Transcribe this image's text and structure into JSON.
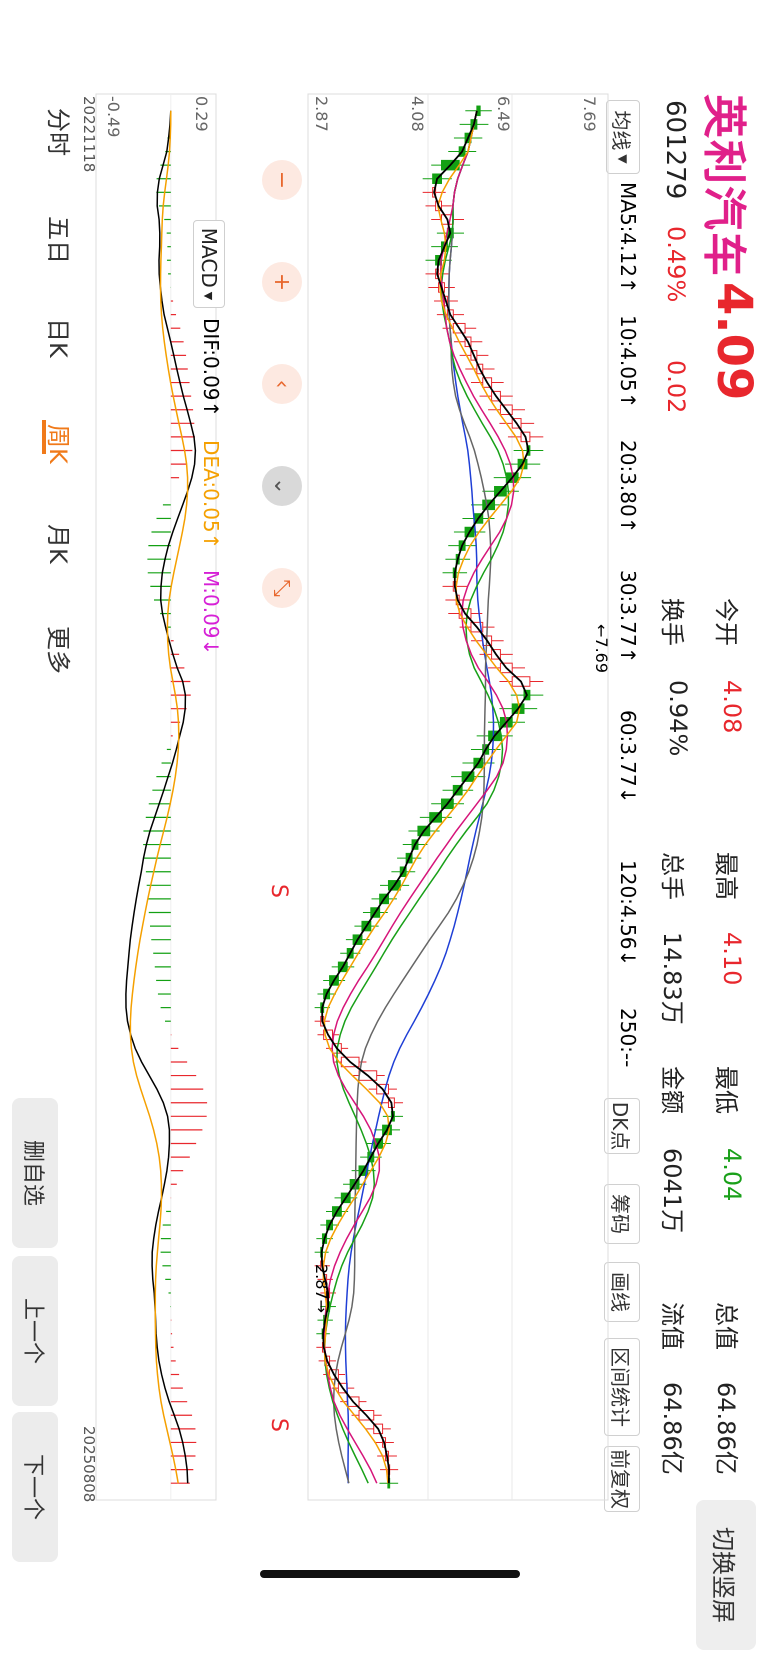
{
  "header": {
    "name": "英利汽车",
    "price": "4.09",
    "code": "601279",
    "pct": "0.49%",
    "change": "0.02",
    "stats": [
      {
        "label": "今开",
        "value": "4.08",
        "color": "#e8272d"
      },
      {
        "label": "换手",
        "value": "0.94%",
        "color": "#222222"
      },
      {
        "label": "最高",
        "value": "4.10",
        "color": "#e8272d"
      },
      {
        "label": "总手",
        "value": "14.83万",
        "color": "#222222"
      },
      {
        "label": "最低",
        "value": "4.04",
        "color": "#1aa01a"
      },
      {
        "label": "金额",
        "value": "6041万",
        "color": "#222222"
      },
      {
        "label": "总值",
        "value": "64.86亿",
        "color": "#222222"
      },
      {
        "label": "流值",
        "value": "64.86亿",
        "color": "#222222"
      }
    ],
    "switch_btn": "切换竖屏"
  },
  "ma": {
    "selector": "均线",
    "items": [
      {
        "text": "MA5:4.12↑",
        "color": "#000000"
      },
      {
        "text": "10:4.05↑",
        "color": "#f5a000"
      },
      {
        "text": "20:3.80↑",
        "color": "#d6157a"
      },
      {
        "text": "30:3.77↑",
        "color": "#18a018"
      },
      {
        "text": "60:3.77↓",
        "color": "#666666"
      },
      {
        "text": "120:4.56↓",
        "color": "#1f3fd6"
      },
      {
        "text": "250:--",
        "color": "#3fb3ea"
      }
    ]
  },
  "tools": [
    "DK点",
    "筹码",
    "画线",
    "区间统计",
    "前复权"
  ],
  "macd": {
    "selector": "MACD",
    "items": [
      {
        "text": "DIF:0.09↑",
        "color": "#000000"
      },
      {
        "text": "DEA:0.05↑",
        "color": "#f5a000"
      },
      {
        "text": "M:0.09↓",
        "color": "#d620d6"
      }
    ]
  },
  "colors": {
    "up": "#e8272d",
    "down": "#13a013",
    "ma5": "#000000",
    "ma10": "#f5a000",
    "ma20": "#d6157a",
    "ma30": "#18a018",
    "ma60": "#666666",
    "ma120": "#1f3fd6"
  },
  "zoom_buttons": [
    "minus-icon",
    "plus-icon",
    "chevron-left-icon",
    "chevron-down-icon",
    "collapse-icon"
  ],
  "tabs": [
    {
      "label": "分时",
      "active": false
    },
    {
      "label": "五日",
      "active": false
    },
    {
      "label": "日K",
      "active": false
    },
    {
      "label": "周K",
      "active": true
    },
    {
      "label": "月K",
      "active": false
    },
    {
      "label": "更多",
      "active": false
    }
  ],
  "bottom_buttons": [
    "删自选",
    "上一个",
    "下一个"
  ],
  "chart_data": [
    {
      "type": "candlestick",
      "title": "",
      "period": "weekly",
      "x_start": "20221118",
      "x_end": "20250808",
      "y_ticks": [
        "7.69",
        "6.49",
        "4.08",
        "2.87"
      ],
      "ylim": [
        2.87,
        7.69
      ],
      "annotations": [
        {
          "text": "←7.69",
          "label": "high marker"
        },
        {
          "text": "2.87→",
          "label": "low marker"
        },
        {
          "text": "S",
          "label": "sell signal"
        },
        {
          "text": "S",
          "label": "sell signal"
        }
      ],
      "close_series": [
        5.6,
        5.5,
        5.4,
        5.3,
        5.0,
        4.85,
        4.9,
        5.0,
        5.2,
        5.1,
        5.0,
        4.9,
        4.95,
        5.05,
        5.1,
        5.2,
        5.4,
        5.5,
        5.6,
        5.7,
        5.85,
        6.0,
        6.2,
        6.35,
        6.5,
        6.45,
        6.3,
        6.1,
        5.9,
        5.7,
        5.55,
        5.4,
        5.3,
        5.25,
        5.2,
        5.25,
        5.3,
        5.5,
        5.7,
        5.85,
        6.0,
        6.2,
        6.5,
        6.4,
        6.2,
        6.0,
        5.8,
        5.7,
        5.55,
        5.35,
        5.2,
        5.0,
        4.8,
        4.6,
        4.5,
        4.4,
        4.3,
        4.1,
        3.95,
        3.8,
        3.65,
        3.5,
        3.4,
        3.25,
        3.1,
        3.0,
        2.95,
        3.0,
        3.15,
        3.3,
        3.6,
        3.9,
        4.1,
        4.2,
        4.15,
        4.0,
        3.85,
        3.75,
        3.6,
        3.45,
        3.3,
        3.15,
        3.05,
        2.98,
        2.95,
        3.0,
        3.05,
        3.1,
        3.05,
        3.0,
        2.98,
        3.02,
        3.1,
        3.25,
        3.4,
        3.6,
        3.85,
        4.0,
        4.05,
        4.1,
        4.12,
        4.09
      ],
      "ma": [
        {
          "name": "MA5",
          "value": "4.12"
        },
        {
          "name": "MA10",
          "value": "4.05"
        },
        {
          "name": "MA20",
          "value": "3.80"
        },
        {
          "name": "MA30",
          "value": "3.77"
        },
        {
          "name": "MA60",
          "value": "3.77"
        },
        {
          "name": "MA120",
          "value": "4.56"
        }
      ]
    },
    {
      "type": "line",
      "title": "MACD",
      "y_ticks": [
        "0.29",
        "-0.49"
      ],
      "ylim": [
        -0.49,
        0.29
      ],
      "series": [
        {
          "name": "DIF",
          "value": "0.09"
        },
        {
          "name": "DEA",
          "value": "0.05"
        },
        {
          "name": "M",
          "value": "0.09"
        }
      ]
    }
  ]
}
